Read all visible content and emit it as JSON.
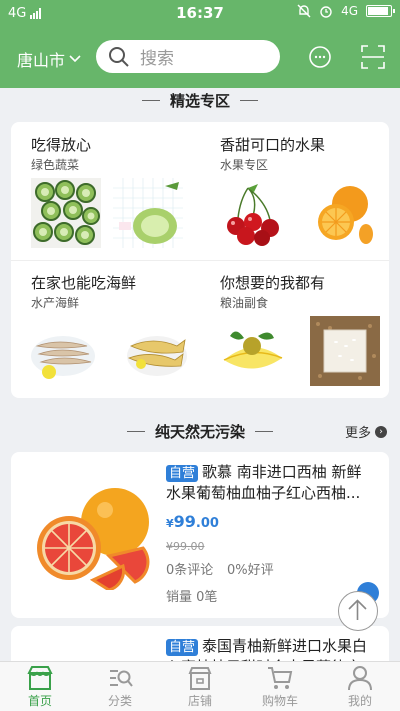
{
  "status_bar": {
    "network": "4G",
    "time": "16:37",
    "network_right": "4G"
  },
  "header": {
    "city": "唐山市",
    "search_placeholder": "搜索"
  },
  "featured": {
    "title": "精选专区",
    "items": [
      {
        "title": "吃得放心",
        "subtitle": "绿色蔬菜"
      },
      {
        "title": "香甜可口的水果",
        "subtitle": "水果专区"
      },
      {
        "title": "在家也能吃海鲜",
        "subtitle": "水产海鲜"
      },
      {
        "title": "你想要的我都有",
        "subtitle": "粮油副食"
      }
    ]
  },
  "natural": {
    "title": "纯天然无污染",
    "more": "更多"
  },
  "products": [
    {
      "tag": "自营",
      "title": "歌慕 南非进口西柚 新鲜水果葡萄柚血柚子红心西柚...",
      "currency": "¥",
      "price_int": "99",
      "price_dec": ".00",
      "old_price": "¥99.00",
      "reviews": "0条评论",
      "rating": "0%好评",
      "sales": "销量 0笔"
    },
    {
      "tag": "自营",
      "title": "泰国青柚新鲜进口水果白心蜜柚柚子甜时令水果菲律宾...",
      "currency": "¥",
      "price_int": "",
      "price_dec": "",
      "old_price": "",
      "reviews": "",
      "rating": "",
      "sales": ""
    }
  ],
  "nav": [
    {
      "label": "首页",
      "active": true
    },
    {
      "label": "分类"
    },
    {
      "label": "店铺"
    },
    {
      "label": "购物车"
    },
    {
      "label": "我的"
    }
  ],
  "colors": {
    "brand_green": "#67b66a",
    "price_blue": "#2f7fd8",
    "nav_active": "#3aa14a"
  }
}
